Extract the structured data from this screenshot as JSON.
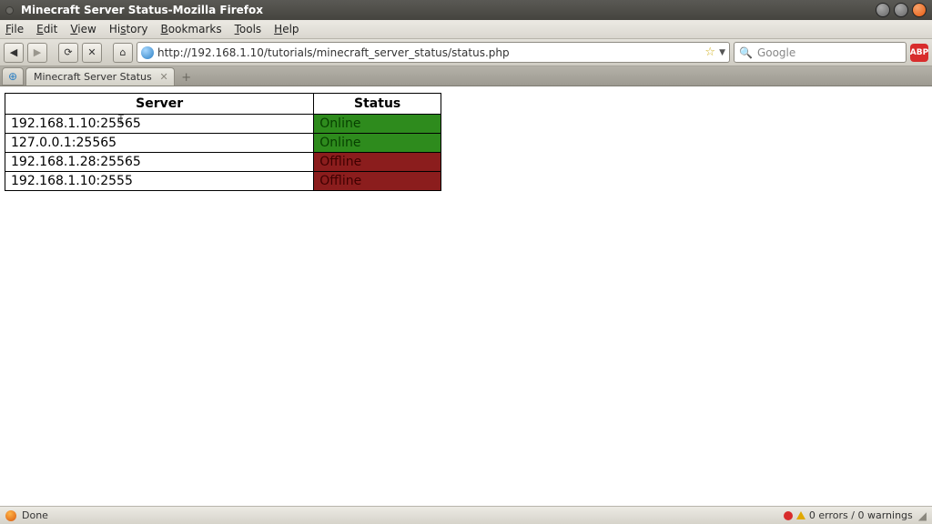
{
  "window": {
    "title": "Minecraft Server Status-Mozilla Firefox"
  },
  "menu": {
    "file": "File",
    "edit": "Edit",
    "view": "View",
    "history": "History",
    "bookmarks": "Bookmarks",
    "tools": "Tools",
    "help": "Help"
  },
  "nav": {
    "url": "http://192.168.1.10/tutorials/minecraft_server_status/status.php",
    "search_placeholder": "Google",
    "abp": "ABP"
  },
  "tabs": {
    "active": "Minecraft Server Status"
  },
  "table": {
    "headers": {
      "server": "Server",
      "status": "Status"
    },
    "rows": [
      {
        "server": "192.168.1.10:25565",
        "status": "Online",
        "state": "on"
      },
      {
        "server": "127.0.0.1:25565",
        "status": "Online",
        "state": "on"
      },
      {
        "server": "192.168.1.28:25565",
        "status": "Offline",
        "state": "off"
      },
      {
        "server": "192.168.1.10:2555",
        "status": "Offline",
        "state": "off"
      }
    ]
  },
  "statusbar": {
    "done": "Done",
    "errors": "0 errors / 0 warnings"
  }
}
